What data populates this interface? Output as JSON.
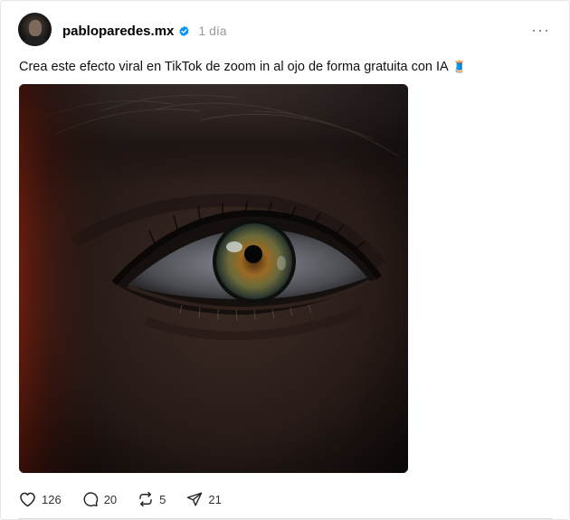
{
  "post": {
    "username": "pabloparedes.mx",
    "time": "1 día",
    "more_label": "···",
    "caption": "Crea este efecto viral en TikTok de zoom in al ojo de forma gratuita con IA",
    "caption_emoji": "🧵"
  },
  "actions": {
    "likes": "126",
    "comments": "20",
    "reposts": "5",
    "shares": "21"
  },
  "colors": {
    "verified": "#0095f6",
    "muted_text": "#999999"
  },
  "icons": [
    "verified-badge-icon",
    "more-icon",
    "heart-icon",
    "comment-icon",
    "repost-icon",
    "share-icon"
  ]
}
